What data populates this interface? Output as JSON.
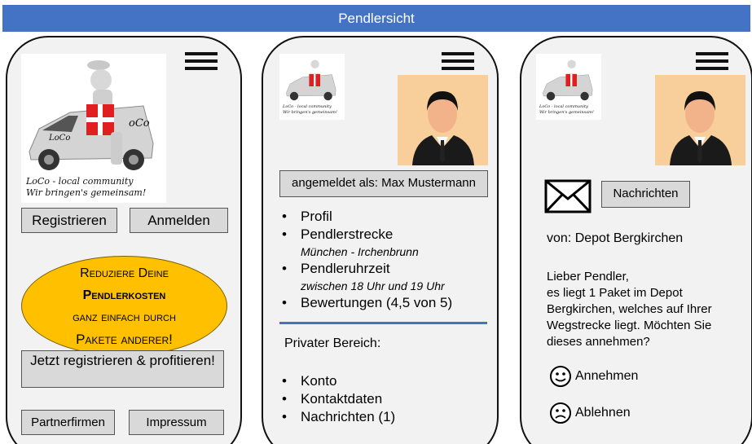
{
  "header": {
    "title": "Pendlersicht"
  },
  "logo": {
    "brand": "LoCo",
    "brand_alt": "oCo",
    "line1": "LoCo - local community",
    "line2": "Wir bringen's gemeinsam!"
  },
  "screen1": {
    "register_label": "Registrieren",
    "login_label": "Anmelden",
    "promo": {
      "line1": "Reduziere Deine",
      "line2": "Pendlerkosten",
      "line3": "ganz einfach durch",
      "line4": "Pakete anderer!"
    },
    "cta_label": "Jetzt registrieren & profitieren!",
    "partner_label": "Partnerfirmen",
    "impressum_label": "Impressum"
  },
  "screen2": {
    "logged_in": "angemeldet als: Max Mustermann",
    "items": [
      {
        "label": "Profil",
        "sub": ""
      },
      {
        "label": "Pendlerstrecke",
        "sub": "München - Irchenbrunn"
      },
      {
        "label": "Pendleruhrzeit",
        "sub": "zwischen 18 Uhr und 19 Uhr"
      },
      {
        "label": "Bewertungen (4,5 von 5)",
        "sub": ""
      }
    ],
    "private_heading": "Privater Bereich:",
    "private_items": [
      "Konto",
      "Kontaktdaten",
      "Nachrichten (1)"
    ]
  },
  "screen3": {
    "messages_label": "Nachrichten",
    "from": "von: Depot Bergkirchen",
    "greeting": "Lieber Pendler,",
    "body": "es liegt 1 Paket im Depot Bergkirchen, welches auf Ihrer Wegstrecke liegt. Möchten Sie dieses annehmen?",
    "accept_label": "Annehmen",
    "decline_label": "Ablehnen"
  },
  "colors": {
    "banner": "#4472c4",
    "promo": "#ffc000",
    "button": "#d9d9d9",
    "separator": "#4472c4",
    "gift": "#e02020"
  },
  "icons": [
    "menu-icon",
    "mail-icon",
    "happy-smiley-icon",
    "sad-smiley-icon",
    "avatar-icon"
  ]
}
